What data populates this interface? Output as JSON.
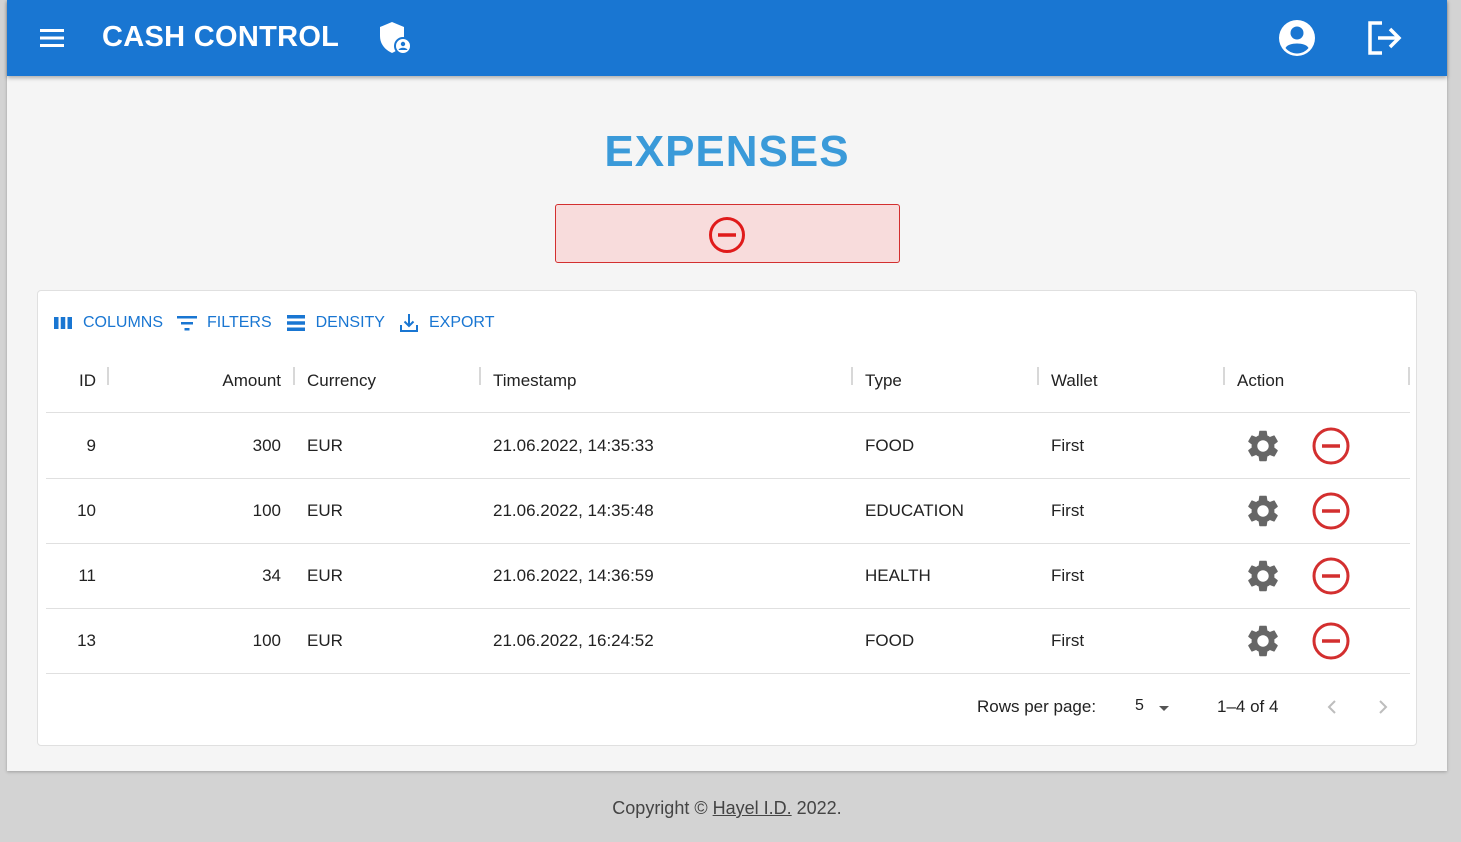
{
  "appbar": {
    "title": "CASH CONTROL",
    "menu_icon": "menu-icon",
    "shield_icon": "admin-shield-icon",
    "account_icon": "account-circle-icon",
    "logout_icon": "logout-icon",
    "color": "#1976d2"
  },
  "page": {
    "heading": "EXPENSES",
    "alert_icon": "minus-circle-icon"
  },
  "toolbar": {
    "columns": "COLUMNS",
    "filters": "FILTERS",
    "density": "DENSITY",
    "export": "EXPORT"
  },
  "table": {
    "columns": [
      "ID",
      "Amount",
      "Currency",
      "Timestamp",
      "Type",
      "Wallet",
      "Action"
    ],
    "rows": [
      {
        "id": "9",
        "amount": "300",
        "currency": "EUR",
        "timestamp": "21.06.2022, 14:35:33",
        "type": "FOOD",
        "wallet": "First"
      },
      {
        "id": "10",
        "amount": "100",
        "currency": "EUR",
        "timestamp": "21.06.2022, 14:35:48",
        "type": "EDUCATION",
        "wallet": "First"
      },
      {
        "id": "11",
        "amount": "34",
        "currency": "EUR",
        "timestamp": "21.06.2022, 14:36:59",
        "type": "HEALTH",
        "wallet": "First"
      },
      {
        "id": "13",
        "amount": "100",
        "currency": "EUR",
        "timestamp": "21.06.2022, 16:24:52",
        "type": "FOOD",
        "wallet": "First"
      }
    ]
  },
  "pagination": {
    "rows_per_page_label": "Rows per page:",
    "rows_per_page": "5",
    "range": "1–4 of 4"
  },
  "footer": {
    "prefix": "Copyright © ",
    "author": "Hayel I.D.",
    "suffix": " 2022."
  }
}
